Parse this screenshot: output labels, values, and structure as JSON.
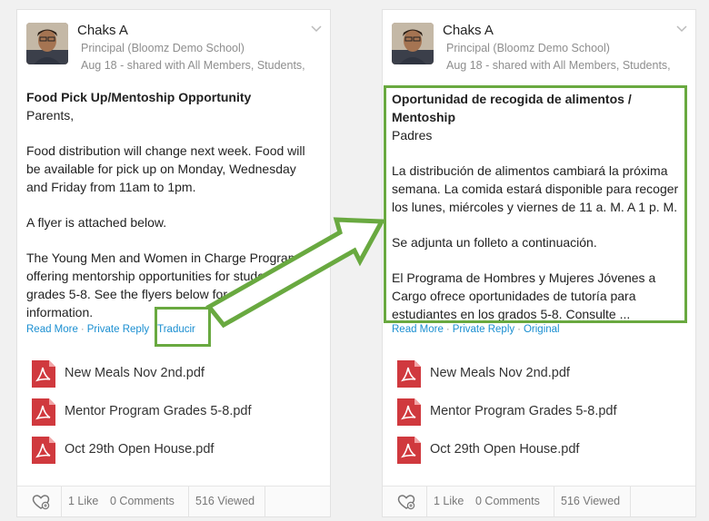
{
  "left_post": {
    "author": "Chaks A",
    "role": "Principal (Bloomz Demo School)",
    "meta": "Aug 18 - shared with All Members, Students,",
    "lines": [
      {
        "text": "Food Pick Up/Mentoship Opportunity",
        "bold": true
      },
      {
        "text": "Parents,"
      },
      {
        "gap": true
      },
      {
        "text": "Food distribution will change next week. Food will"
      },
      {
        "text": "be available for pick up on Monday, Wednesday"
      },
      {
        "text": "and Friday from 11am to 1pm."
      },
      {
        "gap": true
      },
      {
        "text": "A flyer is attached below."
      },
      {
        "gap": true
      },
      {
        "text": "The Young Men and Women in Charge Program is"
      },
      {
        "text": "offering mentorship opportunities for students in"
      },
      {
        "text": "grades 5-8. See the flyers below for more"
      },
      {
        "text": "information."
      }
    ],
    "read_more": "Read More",
    "private_reply": "Private Reply",
    "translate": "Traducir",
    "attachments": [
      "New Meals Nov 2nd.pdf",
      "Mentor Program Grades 5-8.pdf",
      "Oct 29th Open House.pdf"
    ],
    "likes": "1 Like",
    "comments": "0 Comments",
    "viewed": "516 Viewed"
  },
  "right_post": {
    "author": "Chaks A",
    "role": "Principal (Bloomz Demo School)",
    "meta": "Aug 18 - shared with All Members, Students,",
    "lines": [
      {
        "text": "Oportunidad de recogida de alimentos /",
        "bold": true
      },
      {
        "text": "Mentoship",
        "bold": true
      },
      {
        "text": "Padres"
      },
      {
        "gap": true
      },
      {
        "text": "La distribución de alimentos cambiará la próxima"
      },
      {
        "text": "semana. La comida estará disponible para recoger"
      },
      {
        "text": "los lunes, miércoles y viernes de 11 a. M. A 1 p. M."
      },
      {
        "gap": true
      },
      {
        "text": "Se adjunta un folleto a continuación."
      },
      {
        "gap": true
      },
      {
        "text": "El Programa de Hombres y Mujeres Jóvenes a"
      },
      {
        "text": "Cargo ofrece oportunidades de tutoría para"
      },
      {
        "text": "estudiantes en los grados 5-8. Consulte ..."
      }
    ],
    "read_more": "Read More",
    "private_reply": "Private Reply",
    "original": "Original",
    "attachments": [
      "New Meals Nov 2nd.pdf",
      "Mentor Program Grades 5-8.pdf",
      "Oct 29th Open House.pdf"
    ],
    "likes": "1 Like",
    "comments": "0 Comments",
    "viewed": "516 Viewed"
  },
  "colors": {
    "highlight": "#69a940",
    "link": "#1b8fd1",
    "pdf": "#d0393e"
  },
  "icons": {
    "pdf": "pdf-icon",
    "heart": "heart-icon",
    "chevron": "chevron-down-icon"
  }
}
